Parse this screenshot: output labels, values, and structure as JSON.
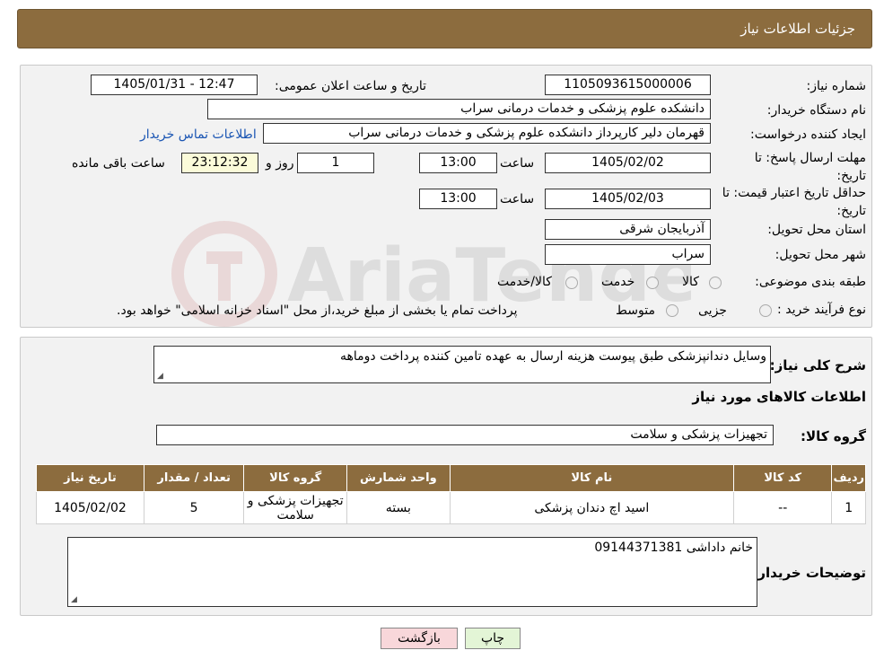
{
  "header": {
    "title": "جزئیات اطلاعات نیاز"
  },
  "form": {
    "need_number_label": "شماره نیاز:",
    "need_number": "1105093615000006",
    "announce_label": "تاریخ و ساعت اعلان عمومی:",
    "announce_value": "1405/01/31 - 12:47",
    "buyer_org_label": "نام دستگاه خریدار:",
    "buyer_org": "دانشکده علوم پزشکی و خدمات درمانی سراب",
    "requester_label": "ایجاد کننده درخواست:",
    "requester": "قهرمان دلیر کارپرداز دانشکده علوم پزشکی و خدمات درمانی سراب",
    "contact_link": "اطلاعات تماس خریدار",
    "deadline_label": "مهلت ارسال پاسخ: تا تاریخ:",
    "deadline_date": "1405/02/02",
    "time_label": "ساعت",
    "deadline_time": "13:00",
    "days_value": "1",
    "days_label": "روز و",
    "remaining_time": "23:12:32",
    "remaining_label": "ساعت باقی مانده",
    "validity_label": "حداقل تاریخ اعتبار قیمت: تا تاریخ:",
    "validity_date": "1405/02/03",
    "validity_time": "13:00",
    "province_label": "استان محل تحویل:",
    "province": "آذربایجان شرقی",
    "city_label": "شهر محل تحویل:",
    "city": "سراب",
    "category_label": "طبقه بندی موضوعی:",
    "category_options": [
      "کالا",
      "خدمت",
      "کالا/خدمت"
    ],
    "process_label": "نوع فرآیند خرید :",
    "process_options": [
      "جزیی",
      "متوسط"
    ],
    "process_note": "پرداخت تمام یا بخشی از مبلغ خرید،از محل \"اسناد خزانه اسلامی\" خواهد بود."
  },
  "details": {
    "summary_label": "شرح کلی نیاز:",
    "summary": "وسایل دندانپزشکی طبق پیوست هزینه ارسال به عهده تامین کننده پرداخت دوماهه",
    "goods_info_title": "اطلاعات کالاهای مورد نیاز",
    "goods_group_label": "گروه کالا:",
    "goods_group": "تجهیزات پزشکی و سلامت",
    "table_headers": [
      "ردیف",
      "کد کالا",
      "نام کالا",
      "واحد شمارش",
      "گروه کالا",
      "تعداد / مقدار",
      "تاریخ نیاز"
    ],
    "rows": [
      [
        "1",
        "--",
        "اسید اچ دندان پزشکی",
        "بسته",
        "تجهیزات پزشکی و سلامت",
        "5",
        "1405/02/02"
      ]
    ],
    "buyer_notes_label": "توضیحات خریدار:",
    "buyer_notes": "خانم داداشی 09144371381"
  },
  "buttons": {
    "print": "چاپ",
    "back": "بازگشت"
  },
  "colors": {
    "header": "#8c6c3e",
    "panel": "#f2f2f2",
    "link": "#1a55b3",
    "back_button": "#f8d7da",
    "print_button": "#e3f5d6"
  },
  "watermark": {
    "text": "AriaTender.neT"
  }
}
